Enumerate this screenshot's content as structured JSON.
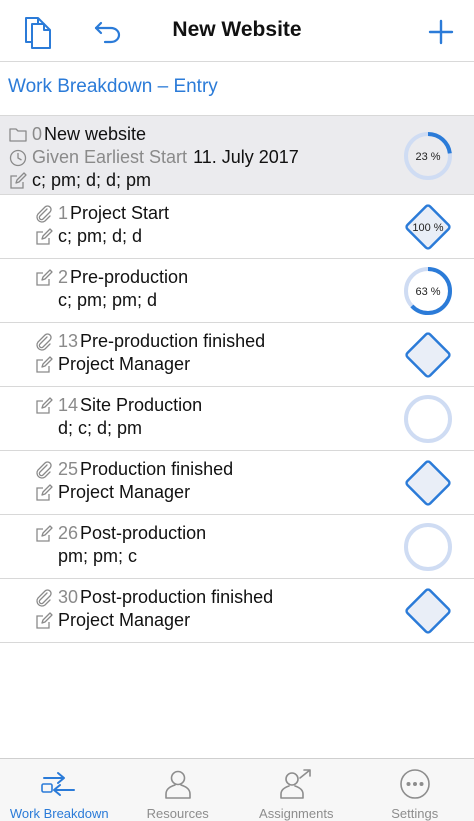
{
  "nav": {
    "title": "New Website"
  },
  "breadcrumb": "Work Breakdown – Entry",
  "colors": {
    "accent": "#2b7bd8",
    "ring_track": "#cfdcf3",
    "diamond_fill": "#e9eef7"
  },
  "root": {
    "number": "0",
    "name": "New website",
    "constraint_label": "Given Earliest Start",
    "constraint_date": "11. July 2017",
    "resources": "c; pm; d; d; pm",
    "progress_label": "23 %",
    "progress": 0.23
  },
  "tasks": [
    {
      "number": "1",
      "name": "Project Start",
      "sub": "c; pm; d; d",
      "icon": "paperclip-icon",
      "status": "milestone",
      "progress_label": "100 %",
      "progress": 1.0
    },
    {
      "number": "2",
      "name": "Pre-production",
      "sub": "c; pm; pm; d",
      "icon": "pencil-icon",
      "status": "ring",
      "progress_label": "63 %",
      "progress": 0.63
    },
    {
      "number": "13",
      "name": "Pre-production finished",
      "sub": "Project Manager",
      "icon": "paperclip-icon",
      "status": "milestone",
      "progress_label": "",
      "progress": 0
    },
    {
      "number": "14",
      "name": "Site Production",
      "sub": "d; c; d; pm",
      "icon": "pencil-icon",
      "status": "ring",
      "progress_label": "",
      "progress": 0
    },
    {
      "number": "25",
      "name": "Production finished",
      "sub": "Project Manager",
      "icon": "paperclip-icon",
      "status": "milestone",
      "progress_label": "",
      "progress": 0
    },
    {
      "number": "26",
      "name": "Post-production",
      "sub": "pm; pm; c",
      "icon": "pencil-icon",
      "status": "ring",
      "progress_label": "",
      "progress": 0
    },
    {
      "number": "30",
      "name": "Post-production finished",
      "sub": "Project Manager",
      "icon": "paperclip-icon",
      "status": "milestone",
      "progress_label": "",
      "progress": 0
    }
  ],
  "tabs": [
    {
      "label": "Work Breakdown",
      "icon": "work-breakdown-icon",
      "active": true
    },
    {
      "label": "Resources",
      "icon": "person-icon",
      "active": false
    },
    {
      "label": "Assignments",
      "icon": "assignments-icon",
      "active": false
    },
    {
      "label": "Settings",
      "icon": "more-icon",
      "active": false
    }
  ]
}
